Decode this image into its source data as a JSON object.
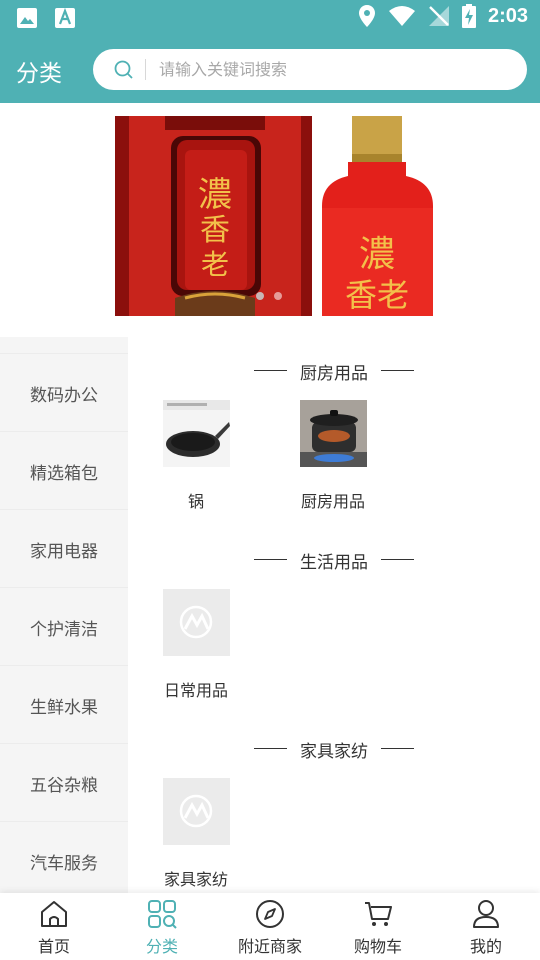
{
  "status_bar": {
    "time": "2:03"
  },
  "header": {
    "title": "分类",
    "search_placeholder": "请输入关键词搜索"
  },
  "banner": {
    "slides": 2,
    "active_slide": 1
  },
  "sidebar": {
    "items": [
      {
        "label": "数码办公"
      },
      {
        "label": "精选箱包"
      },
      {
        "label": "家用电器"
      },
      {
        "label": "个护清洁"
      },
      {
        "label": "生鲜水果"
      },
      {
        "label": "五谷杂粮"
      },
      {
        "label": "汽车服务"
      }
    ]
  },
  "sections": [
    {
      "title": "厨房用品",
      "items": [
        {
          "label": "锅",
          "image": "frying-pan"
        },
        {
          "label": "厨房用品",
          "image": "cooking-pot"
        }
      ]
    },
    {
      "title": "生活用品",
      "items": [
        {
          "label": "日常用品",
          "image": "placeholder-logo"
        }
      ]
    },
    {
      "title": "家具家纺",
      "items": [
        {
          "label": "家具家纺",
          "image": "placeholder-logo"
        }
      ]
    }
  ],
  "tabbar": {
    "items": [
      {
        "label": "首页",
        "icon": "home-icon"
      },
      {
        "label": "分类",
        "icon": "category-icon",
        "active": true
      },
      {
        "label": "附近商家",
        "icon": "compass-icon"
      },
      {
        "label": "购物车",
        "icon": "cart-icon"
      },
      {
        "label": "我的",
        "icon": "user-icon"
      }
    ]
  },
  "colors": {
    "accent": "#4fb1b4",
    "sidebar_bg": "#f5f5f5"
  }
}
